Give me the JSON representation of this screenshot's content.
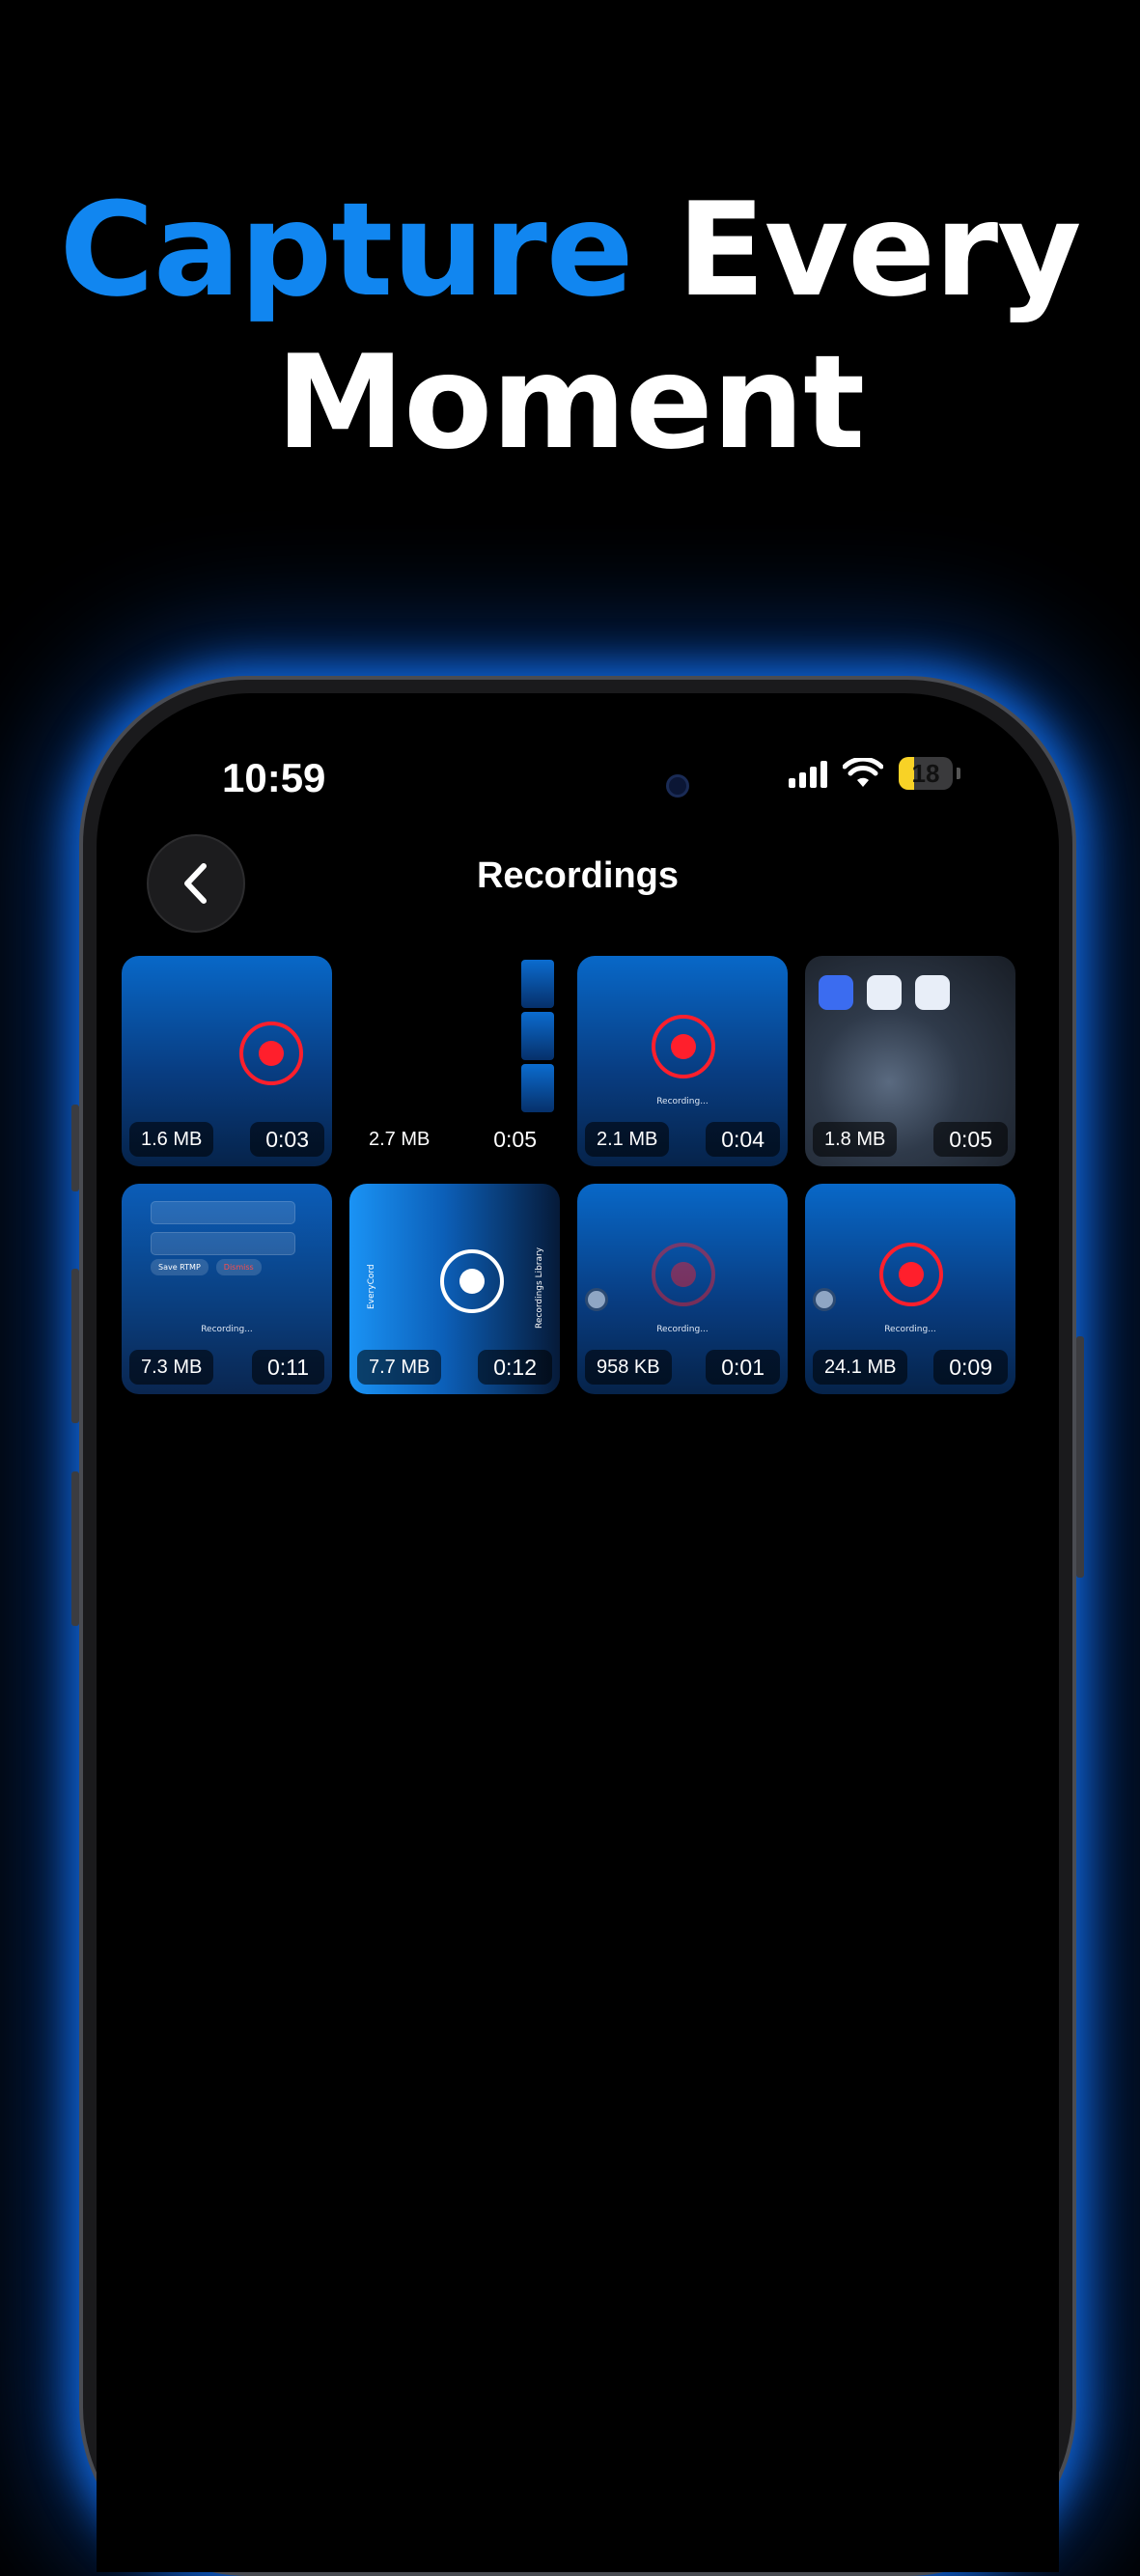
{
  "headline": {
    "accent": "Capture",
    "rest_line1": "Every",
    "line2": "Moment"
  },
  "status_bar": {
    "time": "10:59",
    "battery": "18"
  },
  "nav": {
    "title": "Recordings"
  },
  "recordings": [
    {
      "size": "1.6 MB",
      "duration": "0:03",
      "caption": ""
    },
    {
      "size": "2.7 MB",
      "duration": "0:05",
      "caption": ""
    },
    {
      "size": "2.1 MB",
      "duration": "0:04",
      "caption": "Recording..."
    },
    {
      "size": "1.8 MB",
      "duration": "0:05",
      "caption": ""
    },
    {
      "size": "7.3 MB",
      "duration": "0:11",
      "caption": "Recording..."
    },
    {
      "size": "7.7 MB",
      "duration": "0:12",
      "caption": ""
    },
    {
      "size": "958 KB",
      "duration": "0:01",
      "caption": "Recording..."
    },
    {
      "size": "24.1 MB",
      "duration": "0:09",
      "caption": "Recording..."
    }
  ],
  "thumb_text": {
    "t5_save": "Save RTMP",
    "t5_dismiss": "Dismiss",
    "t6_left": "EveryCord",
    "t6_right": "Recordings Library"
  },
  "colors": {
    "accent": "#1186f0",
    "record_red": "#ff1f2c",
    "glow": "#1478ff"
  }
}
